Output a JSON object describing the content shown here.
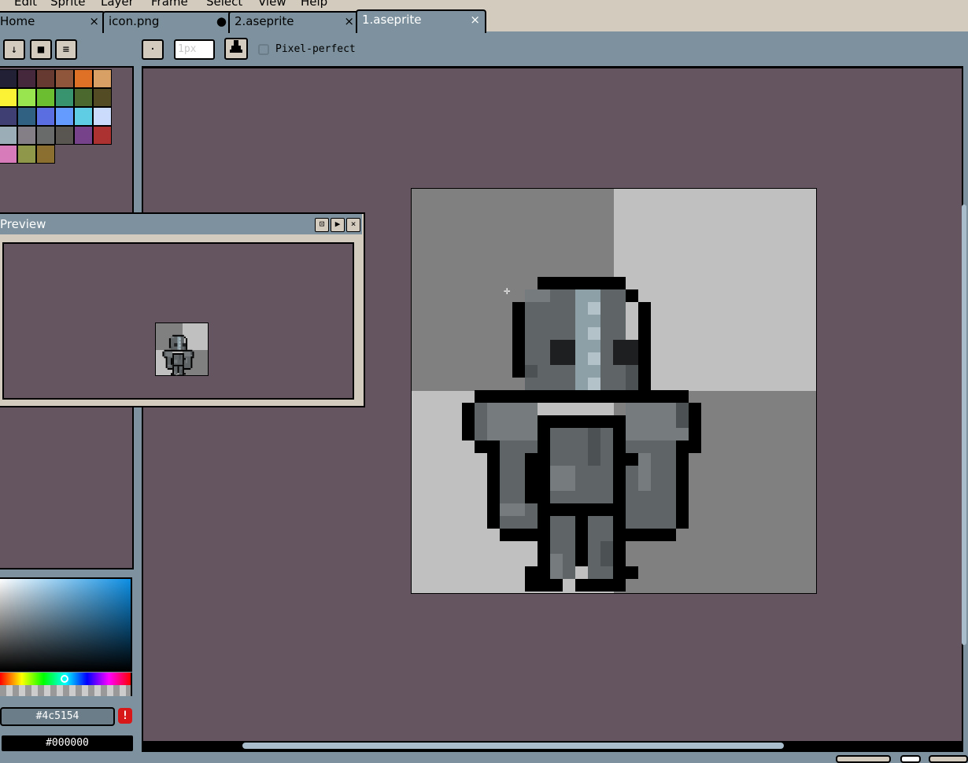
{
  "menu": {
    "items": [
      "Edit",
      "Sprite",
      "Layer",
      "Frame",
      "Select",
      "View",
      "Help"
    ]
  },
  "tabs": [
    {
      "label": "Home",
      "status": "×",
      "active": false
    },
    {
      "label": "icon.png",
      "status": "●",
      "active": false
    },
    {
      "label": "2.aseprite",
      "status": "×",
      "active": false
    },
    {
      "label": "1.aseprite",
      "status": "×",
      "active": true
    }
  ],
  "toolbar": {
    "palette_buttons": [
      "↓",
      "■",
      "≡"
    ],
    "brush_shape": "·",
    "brush_size_placeholder": "1px",
    "ink_icon": "ink-icon",
    "pixel_perfect_label": "Pixel-perfect",
    "pixel_perfect_checked": false
  },
  "palette": {
    "colors": [
      "#222034",
      "#45283c",
      "#663931",
      "#8f563b",
      "#df7126",
      "#d9a066",
      "#fbf236",
      "#99e550",
      "#6abe30",
      "#37946e",
      "#4b692f",
      "#524b24",
      "#3f3f74",
      "#306082",
      "#5b6ee1",
      "#639bff",
      "#5fcde4",
      "#cbdbfc",
      "#9badb7",
      "#847e87",
      "#696a6a",
      "#595652",
      "#76428a",
      "#ac3232",
      "#d77bba",
      "#8f974a",
      "#8a6f30"
    ]
  },
  "color": {
    "foreground": "#4c5154",
    "background": "#000000",
    "warning": "!"
  },
  "preview": {
    "title": "Preview",
    "buttons": [
      "⊡",
      "▶",
      "×"
    ]
  },
  "canvas": {
    "checker_light": "#c0c0c0",
    "checker_dark": "#808080"
  }
}
